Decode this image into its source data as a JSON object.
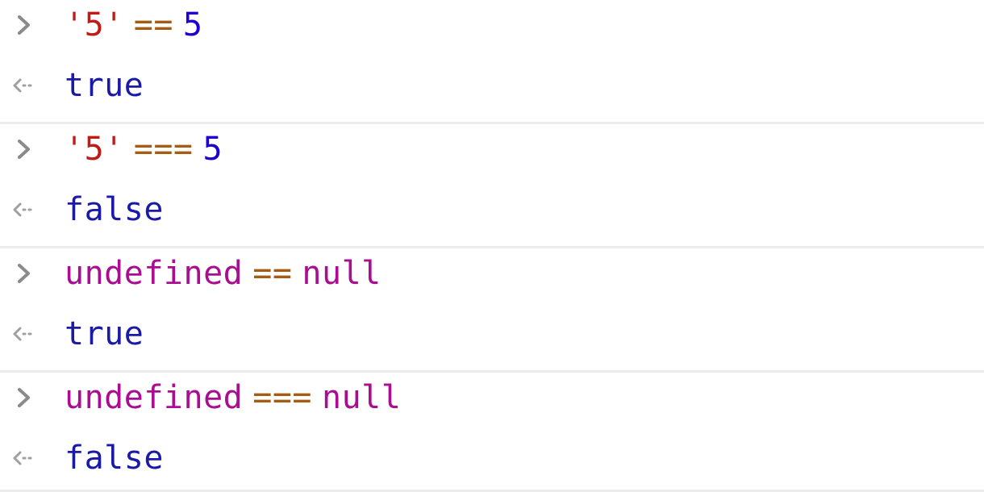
{
  "console": {
    "entries": [
      {
        "input": {
          "lhs": "'5'",
          "op": "==",
          "rhs": "5",
          "lhs_type": "string",
          "rhs_type": "number"
        },
        "output": "true"
      },
      {
        "input": {
          "lhs": "'5'",
          "op": "===",
          "rhs": "5",
          "lhs_type": "string",
          "rhs_type": "number"
        },
        "output": "false"
      },
      {
        "input": {
          "lhs": "undefined",
          "op": "==",
          "rhs": "null",
          "lhs_type": "keyword",
          "rhs_type": "keyword"
        },
        "output": "true"
      },
      {
        "input": {
          "lhs": "undefined",
          "op": "===",
          "rhs": "null",
          "lhs_type": "keyword",
          "rhs_type": "keyword"
        },
        "output": "false"
      }
    ],
    "icons": {
      "input_prompt": "chevron-right-icon",
      "output_prompt": "arrow-left-icon"
    },
    "colors": {
      "string": "#c41a16",
      "operator": "#a65c13",
      "number": "#1c00cf",
      "keyword": "#aa0d91",
      "result": "#1a1aa6",
      "prompt_icon": "#8a8a8a",
      "divider": "#ececec"
    }
  }
}
